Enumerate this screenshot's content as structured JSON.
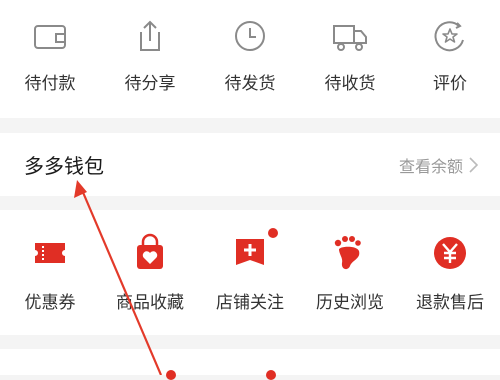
{
  "orders": {
    "items": [
      {
        "label": "待付款",
        "icon": "wallet-icon"
      },
      {
        "label": "待分享",
        "icon": "share-icon"
      },
      {
        "label": "待发货",
        "icon": "clock-icon"
      },
      {
        "label": "待收货",
        "icon": "truck-icon"
      },
      {
        "label": "评价",
        "icon": "star-rating-icon"
      }
    ]
  },
  "wallet": {
    "title": "多多钱包",
    "link": "查看余额"
  },
  "tools": {
    "items": [
      {
        "label": "优惠券",
        "icon": "coupon-icon"
      },
      {
        "label": "商品收藏",
        "icon": "heart-bag-icon"
      },
      {
        "label": "店铺关注",
        "icon": "store-follow-icon"
      },
      {
        "label": "历史浏览",
        "icon": "footprint-icon"
      },
      {
        "label": "退款售后",
        "icon": "refund-yen-icon"
      }
    ]
  },
  "colors": {
    "accent": "#e02e24",
    "icon_stroke": "#8a8a8a",
    "text": "#333333",
    "muted": "#999999",
    "background": "#f4f4f4"
  }
}
